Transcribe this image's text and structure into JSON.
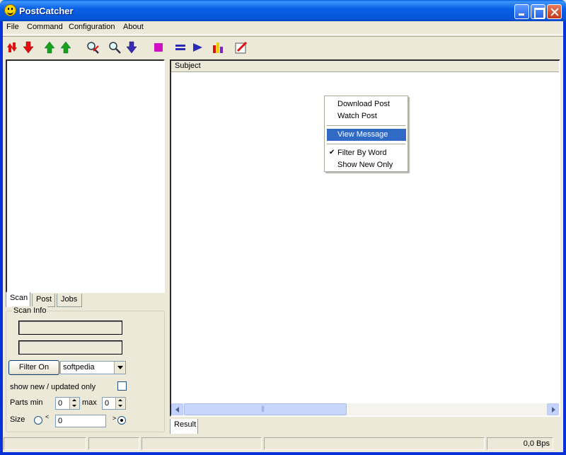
{
  "window": {
    "title": "PostCatcher"
  },
  "menu": [
    "File",
    "Command",
    "Configuration",
    "About"
  ],
  "toolbar_icons": [
    "red-arrows-icon",
    "red-down-arrow-icon",
    "green-up-arrow-icon",
    "green-up-arrow-2-icon",
    "magnify-remove-icon",
    "magnify-icon",
    "blue-down-arrow-icon",
    "stop-icon",
    "equals-icon",
    "play-icon",
    "bar-chart-icon",
    "edit-icon"
  ],
  "left_tabs": [
    "Scan",
    "Post",
    "Jobs"
  ],
  "scan_info": {
    "legend": "Scan Info",
    "filter_button": "Filter On",
    "filter_value": "softpedia",
    "show_new_label": "show new / updated only",
    "parts_min_label": "Parts min",
    "parts_min_value": "0",
    "parts_max_label": "max",
    "parts_max_value": "0",
    "size_label": "Size",
    "size_value": "0",
    "size_left_symbol": "<",
    "size_right_symbol": ">"
  },
  "right_panel": {
    "column_subject": "Subject"
  },
  "context_menu": {
    "items": [
      "Download Post",
      "Watch Post",
      "View Message",
      "Filter By Word",
      "Show New Only"
    ],
    "highlighted": "View Message",
    "checked": "Filter By Word"
  },
  "right_tabs": [
    "Result"
  ],
  "status": {
    "speed": "0,0 Bps"
  }
}
